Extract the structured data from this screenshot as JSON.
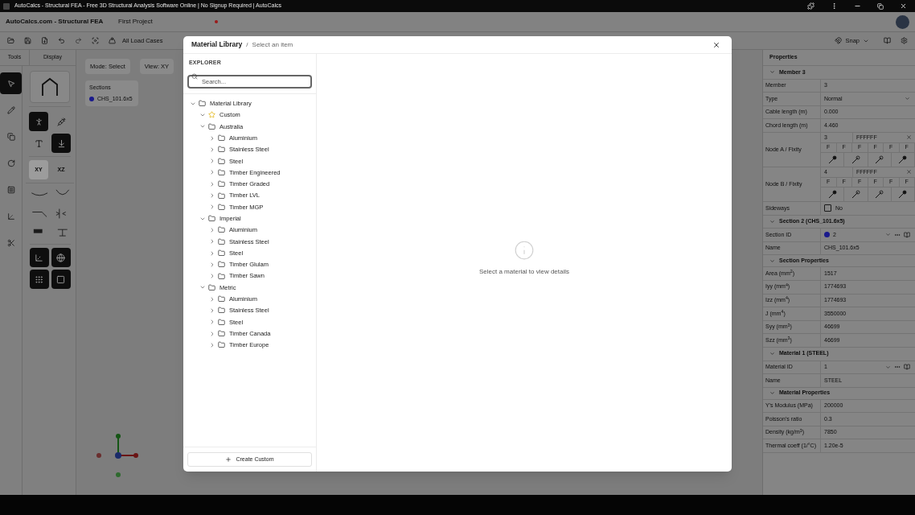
{
  "browser": {
    "title": "AutoCalcs - Structural FEA - Free 3D Structural Analysis Software Online | No Signup Required | AutoCalcs"
  },
  "app_header": {
    "brand": "AutoCalcs.com - Structural FEA",
    "project": "First Project",
    "unsaved": true
  },
  "toolbar": {
    "load_cases": "All Load Cases",
    "snap": "Snap"
  },
  "side_tabs": [
    {
      "label": "Tools"
    },
    {
      "label": "Display"
    }
  ],
  "tools": [
    {
      "kind": "select",
      "selected": true
    },
    {
      "kind": "pencil",
      "selected": false
    },
    {
      "kind": "copy",
      "selected": false
    },
    {
      "kind": "rotate",
      "selected": false
    },
    {
      "kind": "panel",
      "selected": false
    },
    {
      "kind": "axes",
      "selected": false
    },
    {
      "kind": "scissors",
      "selected": false
    }
  ],
  "display": {
    "toggles": [
      {
        "kind": "support",
        "on": true
      },
      {
        "kind": "probe",
        "on": false
      },
      {
        "kind": "text",
        "on": false
      },
      {
        "kind": "load",
        "on": true
      }
    ],
    "planes": [
      {
        "label": "XY",
        "selected": true
      },
      {
        "label": "XZ",
        "selected": false
      }
    ],
    "views": [
      {
        "kind": "axes",
        "on": true
      },
      {
        "kind": "sphere",
        "on": true
      },
      {
        "kind": "nodes",
        "on": true
      },
      {
        "kind": "arch",
        "on": true
      }
    ]
  },
  "canvas": {
    "mode": "Mode: Select",
    "view": "View: XY",
    "sections": {
      "title": "Sections",
      "items": [
        {
          "name": "CHS_101.6x5",
          "color": "#1a1a8c"
        }
      ]
    }
  },
  "modal": {
    "title": "Material Library",
    "separator": "/",
    "subtitle": "Select an item",
    "explorer_label": "EXPLORER",
    "search": {
      "placeholder": "Search..."
    },
    "tree": {
      "label": "Material Library",
      "kind": "folder",
      "expanded": true,
      "children": [
        {
          "label": "Custom",
          "kind": "favorite",
          "expanded": true
        },
        {
          "label": "Australia",
          "kind": "folder",
          "expanded": true,
          "children": [
            {
              "label": "Aluminium",
              "kind": "folder",
              "expanded": false
            },
            {
              "label": "Stainless Steel",
              "kind": "folder",
              "expanded": false
            },
            {
              "label": "Steel",
              "kind": "folder",
              "expanded": false
            },
            {
              "label": "Timber Engineered",
              "kind": "folder",
              "expanded": false
            },
            {
              "label": "Timber Graded",
              "kind": "folder",
              "expanded": false
            },
            {
              "label": "Timber LVL",
              "kind": "folder",
              "expanded": false
            },
            {
              "label": "Timber MGP",
              "kind": "folder",
              "expanded": false
            }
          ]
        },
        {
          "label": "Imperial",
          "kind": "folder",
          "expanded": true,
          "children": [
            {
              "label": "Aluminium",
              "kind": "folder",
              "expanded": false
            },
            {
              "label": "Stainless Steel",
              "kind": "folder",
              "expanded": false
            },
            {
              "label": "Steel",
              "kind": "folder",
              "expanded": false
            },
            {
              "label": "Timber Glulam",
              "kind": "folder",
              "expanded": false
            },
            {
              "label": "Timber Sawn",
              "kind": "folder",
              "expanded": false
            }
          ]
        },
        {
          "label": "Metric",
          "kind": "folder",
          "expanded": true,
          "children": [
            {
              "label": "Aluminium",
              "kind": "folder",
              "expanded": false
            },
            {
              "label": "Stainless Steel",
              "kind": "folder",
              "expanded": false
            },
            {
              "label": "Steel",
              "kind": "folder",
              "expanded": false
            },
            {
              "label": "Timber Canada",
              "kind": "folder",
              "expanded": false
            },
            {
              "label": "Timber Europe",
              "kind": "folder",
              "expanded": false
            }
          ]
        }
      ]
    },
    "create_button": "Create Custom",
    "empty_message": "Select a material to view details"
  },
  "properties": {
    "title": "Properties",
    "rows": [
      {
        "kind": "header",
        "label": "Member 3",
        "expanded": true
      },
      {
        "kind": "row",
        "label": "Member",
        "value": "3"
      },
      {
        "kind": "select",
        "label": "Type",
        "value": "Normal"
      },
      {
        "kind": "row",
        "label": "Cable length (m)",
        "value": "0.000"
      },
      {
        "kind": "row",
        "label": "Chord length (m)",
        "value": "4.460"
      },
      {
        "kind": "node",
        "label": "Node A / Fixity",
        "node": "3",
        "code": "FFFFFF",
        "fixity": [
          "F",
          "F",
          "F",
          "F",
          "F",
          "F"
        ]
      },
      {
        "kind": "node",
        "label": "Node B / Fixity",
        "node": "4",
        "code": "FFFFFF",
        "fixity": [
          "F",
          "F",
          "F",
          "F",
          "F",
          "F"
        ]
      },
      {
        "kind": "checkbox",
        "label": "Sideways",
        "checked": false,
        "value": "No"
      },
      {
        "kind": "header",
        "label": "Section 2 (CHS_101.6x5)",
        "expanded": true
      },
      {
        "kind": "select",
        "label": "Section ID",
        "value": "2",
        "color": "#1a1a8c",
        "tools": true
      },
      {
        "kind": "row",
        "label": "Name",
        "value": "CHS_101.6x5"
      },
      {
        "kind": "subheader",
        "label": "Section Properties",
        "expanded": true
      },
      {
        "kind": "row",
        "label": "Area (mm$^{2}$)",
        "value": "1517"
      },
      {
        "kind": "row",
        "label": "Iyy (mm$^{4}$)",
        "value": "1774693"
      },
      {
        "kind": "row",
        "label": "Izz (mm$^{4}$)",
        "value": "1774693"
      },
      {
        "kind": "row",
        "label": "J (mm$^{4}$)",
        "value": "3550000"
      },
      {
        "kind": "row",
        "label": "Syy (mm$^{3}$)",
        "value": "46699"
      },
      {
        "kind": "row",
        "label": "Szz (mm$^{3}$)",
        "value": "46699"
      },
      {
        "kind": "header",
        "label": "Material 1 (STEEL)",
        "expanded": true
      },
      {
        "kind": "select",
        "label": "Material ID",
        "value": "1",
        "tools": true
      },
      {
        "kind": "row",
        "label": "Name",
        "value": "STEEL"
      },
      {
        "kind": "subheader",
        "label": "Material Properties",
        "expanded": true
      },
      {
        "kind": "row",
        "label": "Y's Modulus (MPa)",
        "value": "200000"
      },
      {
        "kind": "row",
        "label": "Poisson's ratio",
        "value": "0.3"
      },
      {
        "kind": "row",
        "label": "Density (kg/m$^{3}$)",
        "value": "7850"
      },
      {
        "kind": "row",
        "label": "Thermal coeff (1/°C)",
        "value": "1.20e-5"
      }
    ]
  }
}
